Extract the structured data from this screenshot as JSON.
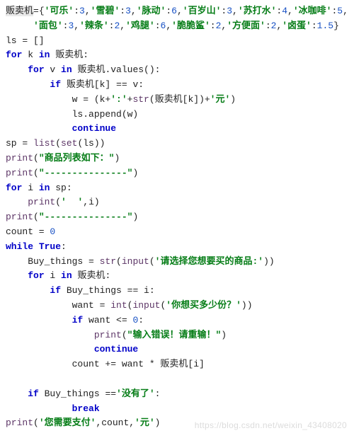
{
  "code_lines": [
    {
      "pad": 0,
      "html": "<span class='hl'>贩卖机</span>={<span class='str'>'可乐'</span>:<span class='num'>3</span>,<span class='str'>'雪碧'</span>:<span class='num'>3</span>,<span class='str'>'脉动'</span>:<span class='num'>6</span>,<span class='str'>'百岁山'</span>:<span class='num'>3</span>,<span class='str'>'苏打水'</span>:<span class='num'>4</span>,<span class='str'>'冰咖啡'</span>:<span class='num'>5</span>,"
    },
    {
      "pad": 5,
      "html": "<span class='str'>'面包'</span>:<span class='num'>3</span>,<span class='str'>'辣条'</span>:<span class='num'>2</span>,<span class='str'>'鸡腿'</span>:<span class='num'>6</span>,<span class='str'>'脆脆鲨'</span>:<span class='num'>2</span>,<span class='str'>'方便面'</span>:<span class='num'>2</span>,<span class='str'>'卤蛋'</span>:<span class='num'>1.5</span>}"
    },
    {
      "pad": 0,
      "html": "ls = []"
    },
    {
      "pad": 0,
      "html": "<span class='kw'>for</span> k <span class='kw'>in</span> 贩卖机:"
    },
    {
      "pad": 4,
      "html": "<span class='kw'>for</span> v <span class='kw'>in</span> 贩卖机.values():"
    },
    {
      "pad": 8,
      "html": "<span class='kw'>if</span> 贩卖机[k] == v:"
    },
    {
      "pad": 12,
      "html": "w = (k+<span class='str'>':'</span>+<span class='func'>str</span>(贩卖机[k])+<span class='str'>'元'</span>)"
    },
    {
      "pad": 12,
      "html": "ls.append(w)"
    },
    {
      "pad": 12,
      "html": "<span class='kw'>continue</span>"
    },
    {
      "pad": 0,
      "html": "sp = <span class='func'>list</span>(<span class='func'>set</span>(ls))"
    },
    {
      "pad": 0,
      "html": "<span class='func'>print</span>(<span class='str'>\"商品列表如下：\"</span>)"
    },
    {
      "pad": 0,
      "html": "<span class='func'>print</span>(<span class='str'>\"---------------\"</span>)"
    },
    {
      "pad": 0,
      "html": "<span class='kw'>for</span> i <span class='kw'>in</span> sp:"
    },
    {
      "pad": 4,
      "html": "<span class='func'>print</span>(<span class='str'>'  '</span>,i)"
    },
    {
      "pad": 0,
      "html": "<span class='func'>print</span>(<span class='str'>\"---------------\"</span>)"
    },
    {
      "pad": 0,
      "html": "count = <span class='num'>0</span>"
    },
    {
      "pad": 0,
      "html": "<span class='kw'>while</span> <span class='kw'>True</span>:"
    },
    {
      "pad": 4,
      "html": "Buy_things = <span class='func'>str</span>(<span class='func'>input</span>(<span class='str'>'请选择您想要买的商品:'</span>))"
    },
    {
      "pad": 4,
      "html": "<span class='kw'>for</span> i <span class='kw'>in</span> 贩卖机:"
    },
    {
      "pad": 8,
      "html": "<span class='kw'>if</span> Buy_things == i:"
    },
    {
      "pad": 12,
      "html": "want = <span class='func'>int</span>(<span class='func'>input</span>(<span class='str'>'你想买多少份？'</span>))"
    },
    {
      "pad": 12,
      "html": "<span class='kw'>if</span> want &lt;= <span class='num'>0</span>:"
    },
    {
      "pad": 16,
      "html": "<span class='func'>print</span>(<span class='str'>\"输入错误！请重输！\"</span>)"
    },
    {
      "pad": 16,
      "html": "<span class='kw'>continue</span>"
    },
    {
      "pad": 12,
      "html": "count += want * 贩卖机[i]"
    },
    {
      "pad": 0,
      "html": ""
    },
    {
      "pad": 4,
      "html": "<span class='kw'>if</span> Buy_things ==<span class='str'>'没有了'</span>:"
    },
    {
      "pad": 12,
      "html": "<span class='kw'>break</span>"
    },
    {
      "pad": 0,
      "html": "<span class='func'>print</span>(<span class='str'>'您需要支付'</span>,count,<span class='str'>'元'</span>)"
    }
  ],
  "watermark": "https://blog.csdn.net/weixin_43408020"
}
